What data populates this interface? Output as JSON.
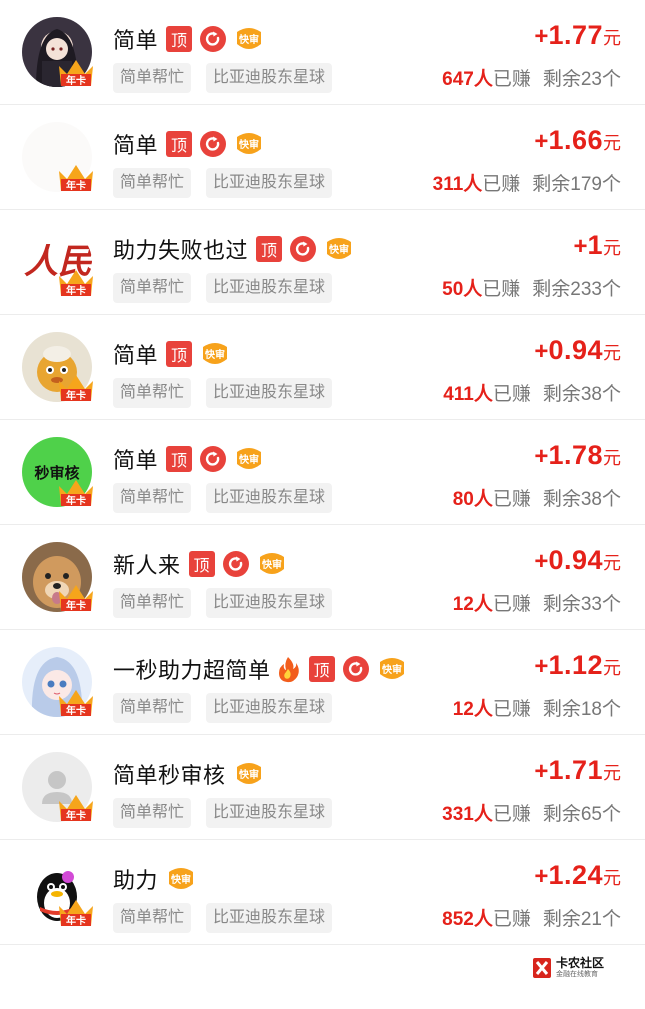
{
  "colors": {
    "accent": "#e5211a",
    "tag_bg": "#f2f2f2",
    "badge_gold": "#f7a21b"
  },
  "badges": {
    "top_label": "顶",
    "fast_label": "快审",
    "nianka_label": "年卡"
  },
  "tasks": [
    {
      "title": "简单",
      "top": true,
      "refresh": true,
      "fire": false,
      "tag1": "简单帮忙",
      "tag2": "比亚迪股东星球",
      "plus": "+",
      "amount": "1.77",
      "unit": "元",
      "earned_count": "647人",
      "earned_label": "已赚",
      "remaining": "剩余23个",
      "avatar": "anime-girl-avatar"
    },
    {
      "title": "简单",
      "top": true,
      "refresh": true,
      "fire": false,
      "tag1": "简单帮忙",
      "tag2": "比亚迪股东星球",
      "plus": "+",
      "amount": "1.66",
      "unit": "元",
      "earned_count": "311人",
      "earned_label": "已赚",
      "remaining": "剩余179个",
      "avatar": "blank-avatar"
    },
    {
      "title": "助力失败也过",
      "top": true,
      "refresh": true,
      "fire": false,
      "tag1": "简单帮忙",
      "tag2": "比亚迪股东星球",
      "plus": "+",
      "amount": "1",
      "unit": "元",
      "earned_count": "50人",
      "earned_label": "已赚",
      "remaining": "剩余233个",
      "avatar": "calligraphy-avatar",
      "avatar_text": "人民"
    },
    {
      "title": "简单",
      "top": true,
      "refresh": false,
      "fire": false,
      "tag1": "简单帮忙",
      "tag2": "比亚迪股东星球",
      "plus": "+",
      "amount": "0.94",
      "unit": "元",
      "earned_count": "411人",
      "earned_label": "已赚",
      "remaining": "剩余38个",
      "avatar": "cartoon-duck-avatar"
    },
    {
      "title": "简单",
      "top": true,
      "refresh": true,
      "fire": false,
      "tag1": "简单帮忙",
      "tag2": "比亚迪股东星球",
      "plus": "+",
      "amount": "1.78",
      "unit": "元",
      "earned_count": "80人",
      "earned_label": "已赚",
      "remaining": "剩余38个",
      "avatar": "green-text-avatar",
      "avatar_text": "秒审核"
    },
    {
      "title": "新人来",
      "top": true,
      "refresh": true,
      "fire": false,
      "tag1": "简单帮忙",
      "tag2": "比亚迪股东星球",
      "plus": "+",
      "amount": "0.94",
      "unit": "元",
      "earned_count": "12人",
      "earned_label": "已赚",
      "remaining": "剩余33个",
      "avatar": "dog-avatar"
    },
    {
      "title": "一秒助力超简单",
      "top": true,
      "refresh": true,
      "fire": true,
      "tag1": "简单帮忙",
      "tag2": "比亚迪股东星球",
      "plus": "+",
      "amount": "1.12",
      "unit": "元",
      "earned_count": "12人",
      "earned_label": "已赚",
      "remaining": "剩余18个",
      "avatar": "anime-girl-blue-avatar"
    },
    {
      "title": "简单秒审核",
      "top": false,
      "refresh": false,
      "fire": false,
      "tag1": "简单帮忙",
      "tag2": "比亚迪股东星球",
      "plus": "+",
      "amount": "1.71",
      "unit": "元",
      "earned_count": "331人",
      "earned_label": "已赚",
      "remaining": "剩余65个",
      "avatar": "default-user-avatar"
    },
    {
      "title": "助力",
      "top": false,
      "refresh": false,
      "fire": false,
      "tag1": "简单帮忙",
      "tag2": "比亚迪股东星球",
      "plus": "+",
      "amount": "1.24",
      "unit": "元",
      "earned_count": "852人",
      "earned_label": "已赚",
      "remaining": "剩余21个",
      "avatar": "qq-penguin-avatar"
    }
  ],
  "watermark": {
    "title": "卡农社区",
    "subtitle": "金融在线教育"
  }
}
